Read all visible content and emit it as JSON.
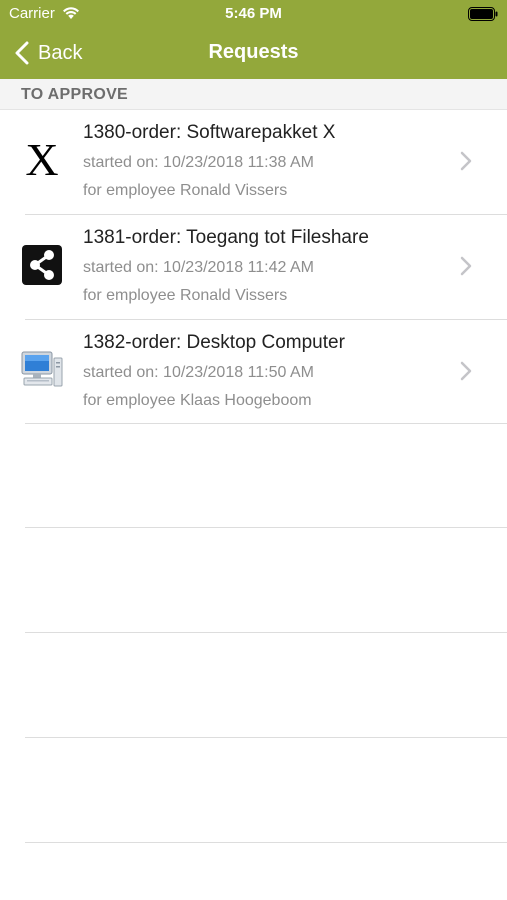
{
  "status_bar": {
    "carrier": "Carrier",
    "time": "5:46 PM"
  },
  "nav": {
    "back_label": "Back",
    "title": "Requests"
  },
  "section": {
    "header": "TO APPROVE"
  },
  "colors": {
    "accent": "#93a83b",
    "separator": "#dddddd",
    "secondary_text": "#8e8e8e"
  },
  "requests": [
    {
      "title": "1380-order: Softwarepakket X",
      "started": "started on: 10/23/2018 11:38 AM",
      "employee": "for employee Ronald Vissers",
      "icon": "x-icon",
      "icon_glyph": "X"
    },
    {
      "title": "1381-order: Toegang tot Fileshare",
      "started": "started on: 10/23/2018 11:42 AM",
      "employee": "for employee Ronald Vissers",
      "icon": "share-icon"
    },
    {
      "title": "1382-order: Desktop Computer",
      "started": "started on: 10/23/2018 11:50 AM",
      "employee": "for employee Klaas Hoogeboom",
      "icon": "desktop-computer-icon"
    }
  ]
}
